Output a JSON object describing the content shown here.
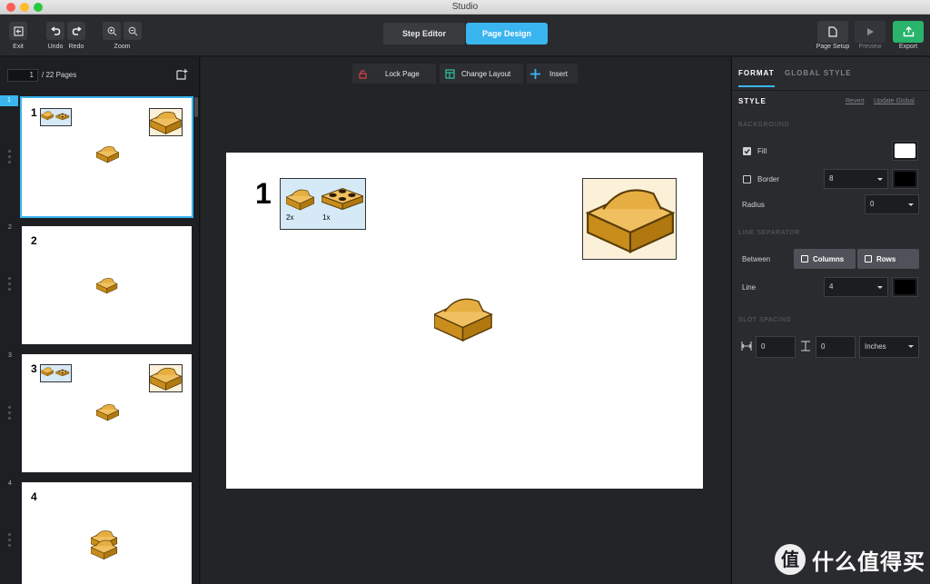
{
  "window": {
    "title": "Studio"
  },
  "toolbar": {
    "exit_label": "Exit",
    "undo_label": "Undo",
    "redo_label": "Redo",
    "zoom_label": "Zoom",
    "mode_step_editor": "Step Editor",
    "mode_page_design": "Page Design",
    "page_setup_label": "Page Setup",
    "preview_label": "Preview",
    "export_label": "Export"
  },
  "pages_panel": {
    "current_page": "1",
    "total_label": "/ 22 Pages",
    "thumbnails": [
      {
        "page_number": "1",
        "step_number": "1",
        "selected": true
      },
      {
        "page_number": "2",
        "step_number": "2",
        "selected": false
      },
      {
        "page_number": "3",
        "step_number": "3",
        "selected": false
      },
      {
        "page_number": "4",
        "step_number": "4",
        "selected": false
      }
    ]
  },
  "canvas_toolbar": {
    "lock_page": "Lock Page",
    "change_layout": "Change Layout",
    "insert": "Insert"
  },
  "page": {
    "step_number": "1",
    "parts": [
      {
        "qty": "2x",
        "part": "slope-brick-icon"
      },
      {
        "qty": "1x",
        "part": "plate-2x2-icon"
      }
    ]
  },
  "format_panel": {
    "tab_format": "FORMAT",
    "tab_global_style": "GLOBAL STYLE",
    "style_heading": "STYLE",
    "revert": "Revert",
    "update_global": "Update Global",
    "background_section": "BACKGROUND",
    "fill_label": "Fill",
    "fill_checked": true,
    "fill_color": "#ffffff",
    "border_label": "Border",
    "border_checked": false,
    "border_width": "8",
    "border_color": "#000000",
    "radius_label": "Radius",
    "radius_value": "0",
    "line_separator_section": "LINE SEPARATOR",
    "between_label": "Between",
    "columns_label": "Columns",
    "rows_label": "Rows",
    "line_label": "Line",
    "line_width": "4",
    "line_color": "#000000",
    "slot_spacing_section": "SLOT SPACING",
    "horizontal_spacing": "0",
    "vertical_spacing": "0",
    "unit": "Inches"
  },
  "colors": {
    "accent": "#3ab5ef",
    "export_green": "#29b36b",
    "brick": "#d9a437",
    "lock_red": "#e0414b"
  },
  "watermark": {
    "text": "什么值得买",
    "logo": "zhi-logo-icon"
  }
}
